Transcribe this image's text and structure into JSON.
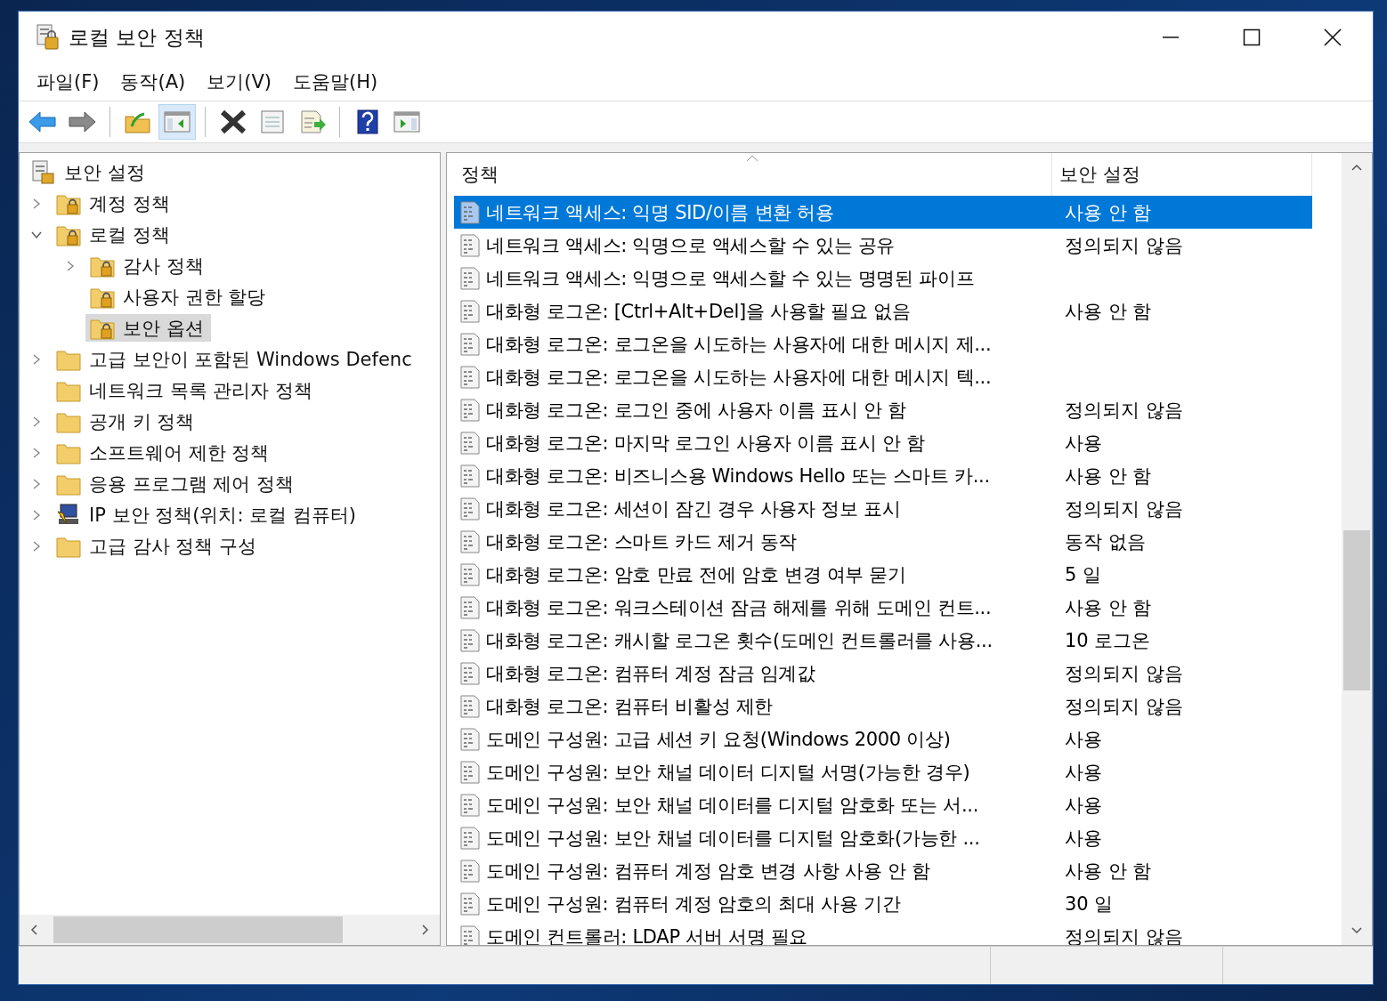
{
  "window": {
    "title": "로컬 보안 정책"
  },
  "menu": [
    "파일(F)",
    "동작(A)",
    "보기(V)",
    "도움말(H)"
  ],
  "toolbar": [
    {
      "kind": "back",
      "pressed": false
    },
    {
      "kind": "forward",
      "pressed": false
    },
    {
      "kind": "separator"
    },
    {
      "kind": "up-folder",
      "pressed": false
    },
    {
      "kind": "show-tree",
      "pressed": true
    },
    {
      "kind": "separator"
    },
    {
      "kind": "delete",
      "pressed": false
    },
    {
      "kind": "properties",
      "pressed": false
    },
    {
      "kind": "export",
      "pressed": false
    },
    {
      "kind": "separator"
    },
    {
      "kind": "help",
      "pressed": false
    },
    {
      "kind": "show-action",
      "pressed": false
    }
  ],
  "tree": [
    {
      "label": "보안 설정",
      "kind": "root",
      "selected": false,
      "children": [
        {
          "label": "계정 정책",
          "kind": "lock-folder",
          "expanded": false,
          "selected": false
        },
        {
          "label": "로컬 정책",
          "kind": "lock-folder",
          "expanded": true,
          "selected": false,
          "children": [
            {
              "label": "감사 정책",
              "kind": "lock-folder",
              "expanded": false,
              "selected": false
            },
            {
              "label": "사용자 권한 할당",
              "kind": "lock-folder",
              "selected": false
            },
            {
              "label": "보안 옵션",
              "kind": "lock-folder",
              "selected": true
            }
          ]
        },
        {
          "label": "고급 보안이 포함된 Windows Defenc",
          "kind": "folder",
          "expanded": false,
          "selected": false
        },
        {
          "label": "네트워크 목록 관리자 정책",
          "kind": "folder",
          "selected": false
        },
        {
          "label": "공개 키 정책",
          "kind": "folder",
          "expanded": false,
          "selected": false
        },
        {
          "label": "소프트웨어 제한 정책",
          "kind": "folder",
          "expanded": false,
          "selected": false
        },
        {
          "label": "응용 프로그램 제어 정책",
          "kind": "folder",
          "expanded": false,
          "selected": false
        },
        {
          "label": "IP 보안 정책(위치: 로컬 컴퓨터)",
          "kind": "computer",
          "expanded": false,
          "selected": false
        },
        {
          "label": "고급 감사 정책 구성",
          "kind": "folder",
          "expanded": false,
          "selected": false
        }
      ]
    }
  ],
  "table": {
    "columns": [
      "정책",
      "보안 설정"
    ],
    "rows": [
      {
        "policy": "네트워크 액세스: 익명 SID/이름 변환 허용",
        "setting": "사용 안 함",
        "selected": true
      },
      {
        "policy": "네트워크 액세스: 익명으로 액세스할 수 있는 공유",
        "setting": "정의되지 않음",
        "selected": false
      },
      {
        "policy": "네트워크 액세스: 익명으로 액세스할 수 있는 명명된 파이프",
        "selected": false
      },
      {
        "policy": "대화형 로그온: [Ctrl+Alt+Del]을 사용할 필요 없음",
        "setting": "사용 안 함",
        "selected": false
      },
      {
        "policy": "대화형 로그온: 로그온을 시도하는 사용자에 대한 메시지 제...",
        "selected": false
      },
      {
        "policy": "대화형 로그온: 로그온을 시도하는 사용자에 대한 메시지 텍...",
        "selected": false
      },
      {
        "policy": "대화형 로그온: 로그인 중에 사용자 이름 표시 안 함",
        "setting": "정의되지 않음",
        "selected": false
      },
      {
        "policy": "대화형 로그온: 마지막 로그인 사용자 이름 표시 안 함",
        "setting": "사용",
        "selected": false
      },
      {
        "policy": "대화형 로그온: 비즈니스용 Windows Hello 또는 스마트 카...",
        "setting": "사용 안 함",
        "selected": false
      },
      {
        "policy": "대화형 로그온: 세션이 잠긴 경우 사용자 정보 표시",
        "setting": "정의되지 않음",
        "selected": false
      },
      {
        "policy": "대화형 로그온: 스마트 카드 제거 동작",
        "setting": "동작 없음",
        "selected": false
      },
      {
        "policy": "대화형 로그온: 암호 만료 전에 암호 변경 여부 묻기",
        "setting": "5 일",
        "selected": false
      },
      {
        "policy": "대화형 로그온: 워크스테이션 잠금 해제를 위해 도메인 컨트...",
        "setting": "사용 안 함",
        "selected": false
      },
      {
        "policy": "대화형 로그온: 캐시할 로그온 횟수(도메인 컨트롤러를 사용...",
        "setting": "10 로그온",
        "selected": false
      },
      {
        "policy": "대화형 로그온: 컴퓨터 계정 잠금 임계값",
        "setting": "정의되지 않음",
        "selected": false
      },
      {
        "policy": "대화형 로그온: 컴퓨터 비활성 제한",
        "setting": "정의되지 않음",
        "selected": false
      },
      {
        "policy": "도메인 구성원: 고급 세션 키 요청(Windows 2000 이상)",
        "setting": "사용",
        "selected": false
      },
      {
        "policy": "도메인 구성원: 보안 채널 데이터 디지털 서명(가능한 경우)",
        "setting": "사용",
        "selected": false
      },
      {
        "policy": "도메인 구성원: 보안 채널 데이터를 디지털 암호화 또는 서...",
        "setting": "사용",
        "selected": false
      },
      {
        "policy": "도메인 구성원: 보안 채널 데이터를 디지털 암호화(가능한 ...",
        "setting": "사용",
        "selected": false
      },
      {
        "policy": "도메인 구성원: 컴퓨터 계정 암호 변경 사항 사용 안 함",
        "setting": "사용 안 함",
        "selected": false
      },
      {
        "policy": "도메인 구성원: 컴퓨터 계정 암호의 최대 사용 기간",
        "setting": "30 일",
        "selected": false
      },
      {
        "policy": "도메인 컨트롤러: LDAP 서버 서명 필요",
        "setting": "정의되지 않음",
        "selected": false
      }
    ]
  }
}
